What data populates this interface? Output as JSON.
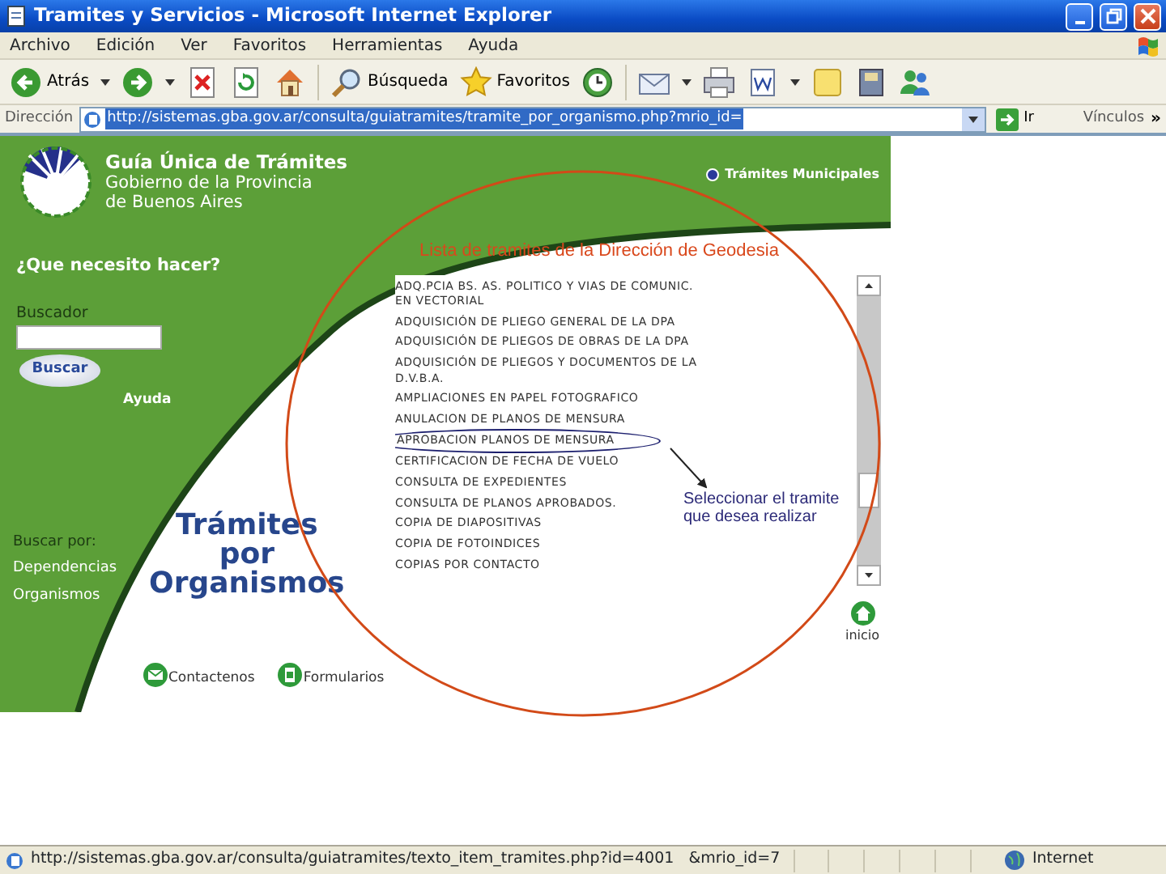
{
  "window": {
    "title": "Tramites y Servicios - Microsoft Internet Explorer"
  },
  "menu": [
    "Archivo",
    "Edición",
    "Ver",
    "Favoritos",
    "Herramientas",
    "Ayuda"
  ],
  "toolbar": [
    {
      "kind": "back",
      "label": "Atrás",
      "dropdown": true
    },
    {
      "kind": "forward",
      "dropdown": true
    },
    {
      "kind": "stop"
    },
    {
      "kind": "refresh"
    },
    {
      "kind": "home"
    },
    {
      "kind": "search",
      "label": "Búsqueda"
    },
    {
      "kind": "favorites",
      "label": "Favoritos"
    },
    {
      "kind": "history"
    },
    {
      "kind": "mail",
      "dropdown": true
    },
    {
      "kind": "print"
    },
    {
      "kind": "edit",
      "dropdown": true
    },
    {
      "kind": "notes"
    },
    {
      "kind": "research"
    },
    {
      "kind": "messenger"
    }
  ],
  "address_bar": {
    "label": "Dirección",
    "url": "http://sistemas.gba.gov.ar/consulta/guiatramites/tramite_por_organismo.php?mrio_id=",
    "url_selected": true,
    "go": "Ir",
    "links": "Vínculos",
    "more": "»"
  },
  "page": {
    "logo": {
      "title": "Guía Única de Trámites",
      "subtitle": [
        "Gobierno de la Provincia",
        "de Buenos Aires"
      ]
    },
    "municipal_link": "Trámites Municipales",
    "question": "¿Que necesito hacer?",
    "search": {
      "label": "Buscador",
      "button": "Buscar",
      "help": "Ayuda"
    },
    "browse": {
      "label": "Buscar por:",
      "links": [
        "Dependencias",
        "Organismos"
      ]
    },
    "heading": [
      "Trámites",
      "por",
      "Organismos"
    ],
    "list_title": "Lista de tramites de la Dirección de Geodesia",
    "procedures": [
      {
        "name": "ADQ.PCIA BS. AS. POLITICO Y VIAS DE COMUNIC. EN VECTORIAL",
        "highlighted": false
      },
      {
        "name": "ADQUISICIÓN DE PLIEGO GENERAL DE LA DPA",
        "highlighted": false
      },
      {
        "name": "ADQUISICIÓN DE PLIEGOS DE OBRAS DE LA DPA",
        "highlighted": false
      },
      {
        "name": "ADQUISICIÓN DE PLIEGOS Y DOCUMENTOS DE LA D.V.B.A.",
        "highlighted": false
      },
      {
        "name": "AMPLIACIONES EN PAPEL FOTOGRAFICO",
        "highlighted": false
      },
      {
        "name": "ANULACION DE PLANOS DE MENSURA",
        "highlighted": false
      },
      {
        "name": "APROBACION PLANOS DE MENSURA",
        "highlighted": true
      },
      {
        "name": "CERTIFICACION DE FECHA DE VUELO",
        "highlighted": false
      },
      {
        "name": "CONSULTA DE EXPEDIENTES",
        "highlighted": false
      },
      {
        "name": "CONSULTA DE PLANOS APROBADOS.",
        "highlighted": false
      },
      {
        "name": "COPIA DE DIAPOSITIVAS",
        "highlighted": false
      },
      {
        "name": "COPIA DE FOTOINDICES",
        "highlighted": false
      },
      {
        "name": "COPIAS POR CONTACTO",
        "highlighted": false
      }
    ],
    "footer_links": [
      {
        "kind": "contact",
        "label": "Contactenos"
      },
      {
        "kind": "forms",
        "label": "Formularios"
      }
    ],
    "home": "inicio"
  },
  "annotation": {
    "text": "Seleccionar el tramite que desea realizar"
  },
  "status_bar": {
    "url": "http://sistemas.gba.gov.ar/consulta/guiatramites/texto_item_tramites.php?id=4001   &mrio_id=7",
    "zone": "Internet"
  }
}
